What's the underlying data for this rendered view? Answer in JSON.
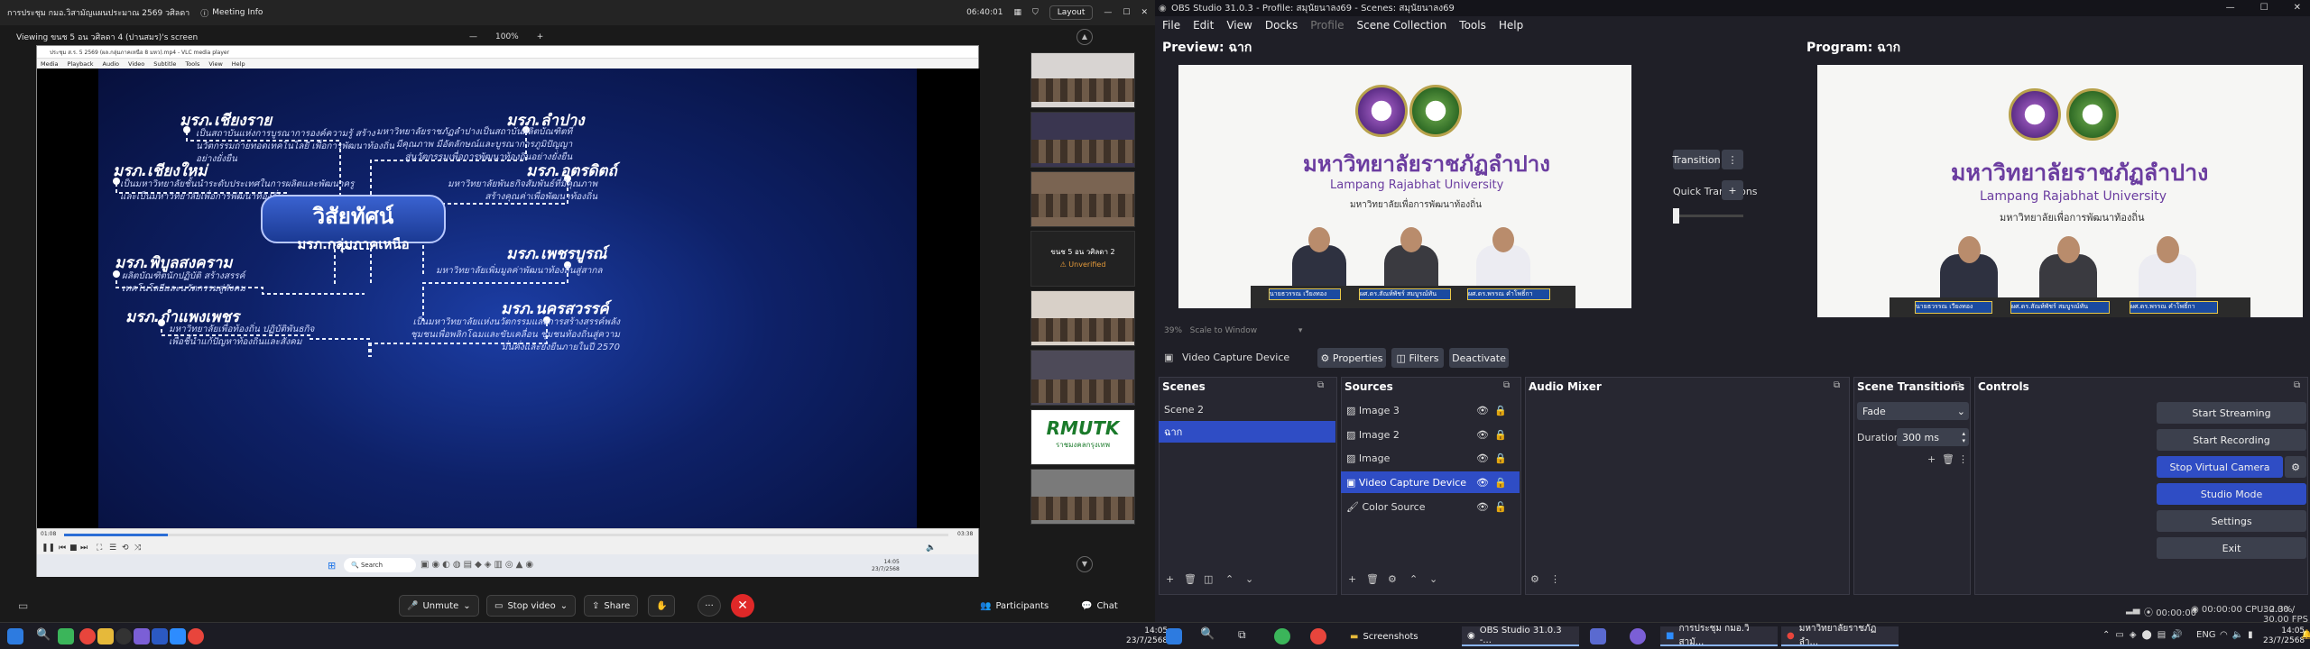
{
  "zoom": {
    "window_title": "การประชุม กมอ.วิสามัญแผนประมาณ 2569 วศิลดา",
    "meeting_info": "Meeting Info",
    "timer": "06:40:01",
    "layout_label": "Layout",
    "viewing_label": "Viewing ขนช 5 อน วศิลดา 4 (ปานสมร)'s screen",
    "zoom_level": "100%",
    "zoom_minus": "—",
    "zoom_plus": "+",
    "vlc": {
      "title": "ประชุม ส.ร. 5 2569 (ผล.กลุ่มภาคเหนือ 8 มหว).mp4 - VLC media player",
      "menu": [
        "Media",
        "Playback",
        "Audio",
        "Video",
        "Subtitle",
        "Tools",
        "View",
        "Help"
      ],
      "time_elapsed": "01:08",
      "time_total": "03:38",
      "search_placeholder": "Search",
      "clock_time": "14:05",
      "clock_date": "23/7/2568"
    },
    "slide": {
      "center_title": "วิสัยทัศน์",
      "center_subtitle": "มรภ.กลุ่มภาคเหนือ",
      "univs": [
        {
          "name": "มรภ.เชียงราย",
          "desc": [
            "เป็นสถาบันแห่งการบูรณาการองค์ความรู้ สร้าง",
            "นวัตกรรมถ่ายทอดเทคโนโลยี เพื่อการพัฒนาท้องถิ่น",
            "อย่างยั่งยืน"
          ]
        },
        {
          "name": "มรภ.เชียงใหม่",
          "desc": [
            "เป็นมหาวิทยาลัยชั้นนำระดับประเทศในการผลิตและพัฒนาครู",
            "และเป็นมหาวิทยาลัยเพื่อการพัฒนาท้องถิ่น"
          ]
        },
        {
          "name": "มรภ.พิบูลสงคราม",
          "desc": [
            "ผลิตบัณฑิตนักปฏิบัติ สร้างสรรค์",
            "เทคโนโลยีและนวัตกรรมสู่สังคม"
          ]
        },
        {
          "name": "มรภ.กำแพงเพชร",
          "desc": [
            "มหาวิทยาลัยเพื่อท้องถิ่น ปฏิบัติพันธกิจ",
            "เพื่อชี้นำแก้ปัญหาท้องถิ่นและสังคม"
          ]
        },
        {
          "name": "มรภ.ลำปาง",
          "desc": [
            "มหาวิทยาลัยราชภัฏลำปางเป็นสถาบันผลิตบัณฑิตที่",
            "มีคุณภาพ มีอัตลักษณ์และบูรณาการภูมิปัญญา",
            "สู่นวัตกรรมเพื่อการพัฒนาท้องถิ่นอย่างยั่งยืน"
          ]
        },
        {
          "name": "มรภ.อุตรดิตถ์",
          "desc": [
            "มหาวิทยาลัยพันธกิจสัมพันธ์ที่มีคุณภาพ",
            "สร้างคุณค่าเพื่อพัฒนาท้องถิ่น"
          ]
        },
        {
          "name": "มรภ.เพชรบูรณ์",
          "desc": [
            "มหาวิทยาลัยเพิ่มมูลค่าพัฒนาท้องถิ่นสู่สากล"
          ]
        },
        {
          "name": "มรภ.นครสวรรค์",
          "desc": [
            "เป็นมหาวิทยาลัยแห่งนวัตกรรมและการสร้างสรรค์พลัง",
            "ชุมชนเพื่อพลิกโฉมและขับเคลื่อน ชุมชนท้องถิ่นสู่ความ",
            "มั่นคั่งและยั่งยืนภายในปี 2570"
          ]
        }
      ]
    },
    "thumbs": {
      "dark_name": "ขนช 5 อน วศิลดา 2",
      "unverified": "Unverified",
      "logo_text": "RMUTK",
      "logo_sub": "ราชมงคลกรุงเทพ"
    },
    "bottom": {
      "unmute": "Unmute",
      "stop_video": "Stop video",
      "share": "Share",
      "participants": "Participants",
      "chat": "Chat"
    }
  },
  "obs": {
    "title": "OBS Studio 31.0.3 - Profile: สมุนัยนาลง69 - Scenes: สมุนัยนาลง69",
    "menu": [
      "File",
      "Edit",
      "View",
      "Docks",
      "Profile",
      "Scene Collection",
      "Tools",
      "Help"
    ],
    "preview_label": "Preview: ฉาก",
    "program_label": "Program: ฉาก",
    "transition_btn": "Transition",
    "quick_transitions": "Quick Transitions",
    "zoom_pct": "39%",
    "scale_to_window": "Scale to Window",
    "source_bar": {
      "source_name": "Video Capture Device",
      "properties": "Properties",
      "filters": "Filters",
      "deactivate": "Deactivate"
    },
    "stage": {
      "thai_name": "มหาวิทยาลัยราชภัฏลำปาง",
      "english_name": "Lampang Rajabhat University",
      "slogan": "มหาวิทยาลัยเพื่อการพัฒนาท้องถิ่น",
      "plates": [
        "นายธวรรณ เวียงทอง",
        "ผศ.ดร.สัณห์พัชร์ สมบูรณ์ทัน",
        "ผศ.ดร.พรรณ คำโพธิ์กา"
      ]
    },
    "scenes": {
      "title": "Scenes",
      "items": [
        "Scene 2",
        "ฉาก"
      ]
    },
    "sources": {
      "title": "Sources",
      "items": [
        "Image 3",
        "Image 2",
        "Image",
        "Video Capture Device",
        "Color Source"
      ]
    },
    "audio_mixer": {
      "title": "Audio Mixer"
    },
    "scene_transitions": {
      "title": "Scene Transitions",
      "type": "Fade",
      "duration_label": "Duration",
      "duration": "300 ms"
    },
    "controls": {
      "title": "Controls",
      "buttons": [
        "Start Streaming",
        "Start Recording",
        "Stop Virtual Camera",
        "Studio Mode",
        "Settings",
        "Exit"
      ]
    },
    "status": {
      "rec_time": "00:00:00",
      "stream_time": "00:00:00",
      "cpu": "CPU: 2.3%",
      "fps": "30.00 / 30.00 FPS"
    }
  },
  "taskbar": {
    "screenshots": "Screenshots",
    "obs_app": "OBS Studio 31.0.3 -...",
    "zoom_app": "การประชุม กมอ.วิสามั...",
    "chrome_app": "มหาวิทยาลัยราชภัฏลำ...",
    "lang": "ENG",
    "time": "14:05",
    "date": "23/7/2568",
    "left_time": "14:05",
    "left_date": "23/7/2568"
  },
  "colors": {
    "obs_accent": "#2f4dc5",
    "zoom_end": "#e02828"
  }
}
